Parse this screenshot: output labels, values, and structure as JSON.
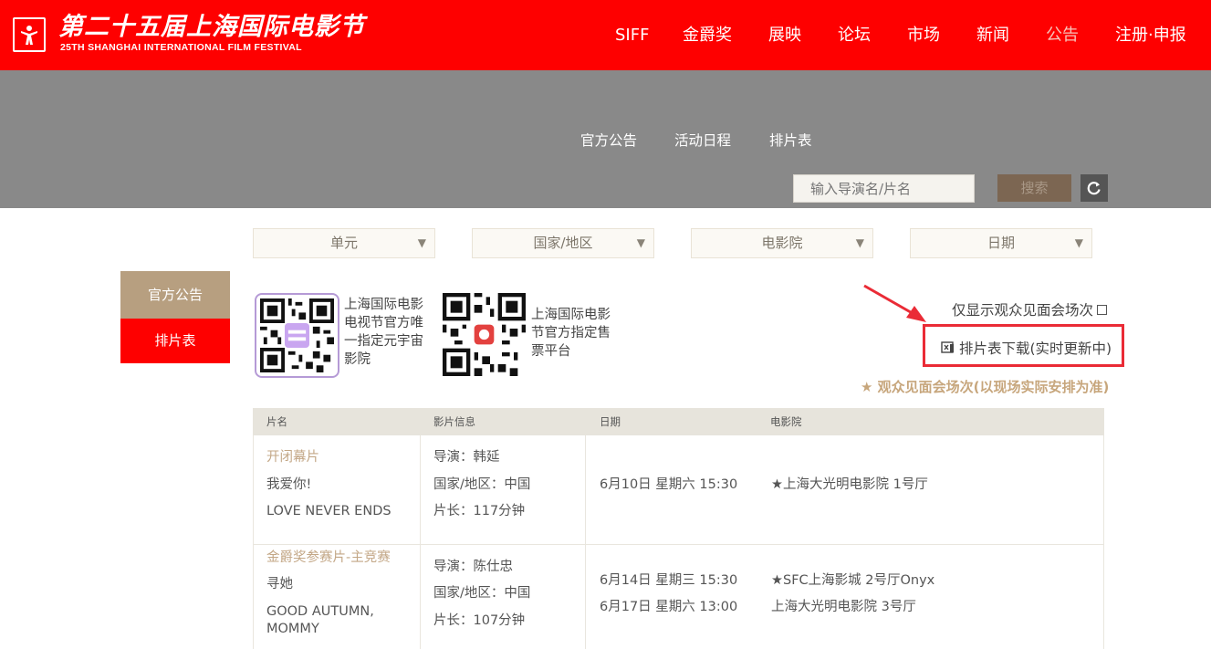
{
  "header": {
    "logo_cn": "第二十五届上海国际电影节",
    "logo_en": "25TH SHANGHAI INTERNATIONAL FILM FESTIVAL",
    "nav": [
      {
        "label": "SIFF",
        "active": false
      },
      {
        "label": "金爵奖",
        "active": false
      },
      {
        "label": "展映",
        "active": false
      },
      {
        "label": "论坛",
        "active": false
      },
      {
        "label": "市场",
        "active": false
      },
      {
        "label": "新闻",
        "active": false
      },
      {
        "label": "公告",
        "active": true
      },
      {
        "label": "注册·申报",
        "active": false
      }
    ]
  },
  "subnav": [
    "官方公告",
    "活动日程",
    "排片表"
  ],
  "search": {
    "placeholder": "输入导演名/片名",
    "button_label": "搜索",
    "refresh_icon": "refresh-icon"
  },
  "filters": [
    {
      "label": "单元"
    },
    {
      "label": "国家/地区"
    },
    {
      "label": "电影院"
    },
    {
      "label": "日期"
    }
  ],
  "sidebar": {
    "items": [
      {
        "label": "官方公告"
      },
      {
        "label": "排片表"
      }
    ]
  },
  "qr_codes": [
    {
      "caption_lines": [
        "上海国际电影",
        "电视节官方唯",
        "一指定元宇宙",
        "影院"
      ]
    },
    {
      "caption_lines": [
        "上海国际电影",
        "节官方指定售",
        "票平台"
      ]
    }
  ],
  "controls": {
    "only_meet_label": "仅显示观众见面会场次",
    "download_label": "排片表下载(实时更新中)",
    "note": "★ 观众见面会场次(以现场实际安排为准)"
  },
  "table": {
    "headers": [
      "片名",
      "影片信息",
      "日期",
      "电影院"
    ],
    "rows": [
      {
        "category": "开闭幕片",
        "title_cn": "我爱你!",
        "title_en_lines": [
          "LOVE NEVER ENDS"
        ],
        "director": "导演：韩延",
        "country": "国家/地区：中国",
        "runtime": "片长：117分钟",
        "screenings": [
          {
            "date": "6月10日 星期六 15:30",
            "cinema": "★上海大光明电影院 1号厅"
          }
        ]
      },
      {
        "category": "金爵奖参赛片-主竞赛",
        "title_cn": "寻她",
        "title_en_lines": [
          "GOOD AUTUMN,",
          "MOMMY"
        ],
        "director": "导演：陈仕忠",
        "country": "国家/地区：中国",
        "runtime": "片长：107分钟",
        "screenings": [
          {
            "date": "6月14日 星期三 15:30",
            "cinema": "★SFC上海影城 2号厅Onyx"
          },
          {
            "date": "6月17日 星期六 13:00",
            "cinema": "上海大光明电影院 3号厅"
          }
        ]
      }
    ]
  },
  "colors": {
    "brand_red": "#fe0000",
    "band_gray": "#898989",
    "accent_tan": "#b79f80",
    "note_gold": "#c7a67c",
    "highlight_red": "#ea2b36"
  }
}
